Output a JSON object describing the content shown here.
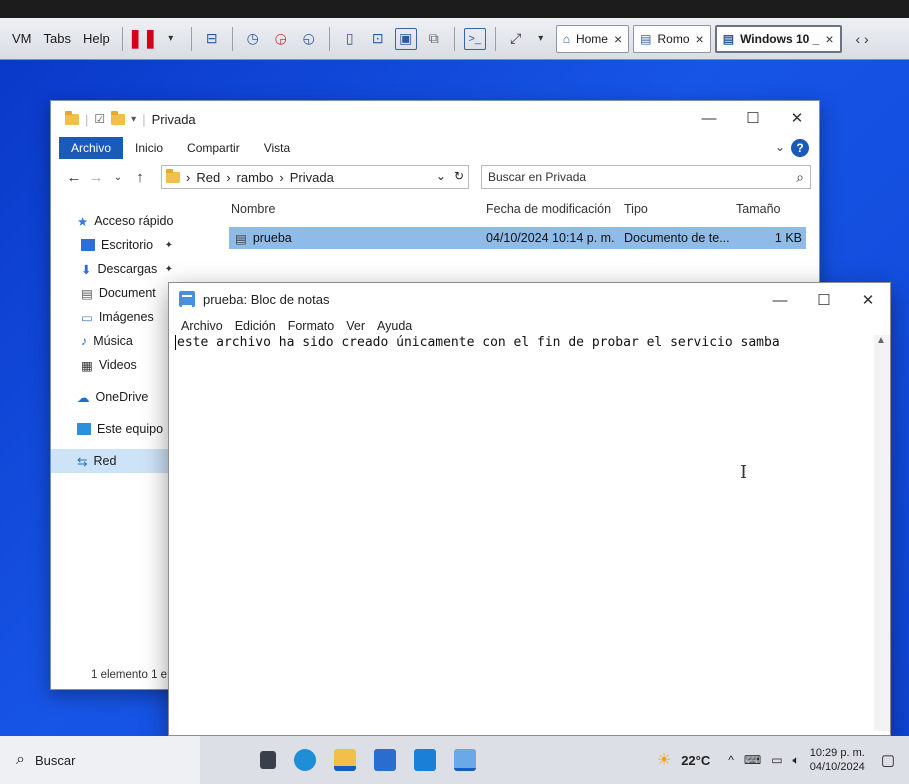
{
  "vm_toolbar": {
    "menus": [
      "VM",
      "Tabs",
      "Help"
    ],
    "tabs": [
      {
        "label": "Home",
        "icon": "home-icon"
      },
      {
        "label": "Romo",
        "icon": "vm-icon"
      },
      {
        "label": "Windows 10 _",
        "icon": "vm-icon",
        "active": true
      }
    ],
    "close_glyph": "×",
    "nav_glyph": "‹ ›"
  },
  "explorer": {
    "title": "Privada",
    "ribbon_tabs": [
      "Archivo",
      "Inicio",
      "Compartir",
      "Vista"
    ],
    "help_glyph": "?",
    "breadcrumb": [
      "Red",
      "rambo",
      "Privada"
    ],
    "search_placeholder": "Buscar en Privada",
    "columns": [
      "Nombre",
      "Fecha de modificación",
      "Tipo",
      "Tamaño"
    ],
    "sidebar": [
      {
        "label": "Acceso rápido",
        "icon": "star-icon"
      },
      {
        "label": "Escritorio",
        "icon": "desktop-icon",
        "pinned": true
      },
      {
        "label": "Descargas",
        "icon": "download-icon",
        "pinned": true
      },
      {
        "label": "Document",
        "icon": "documents-icon"
      },
      {
        "label": "Imágenes",
        "icon": "pictures-icon"
      },
      {
        "label": "Música",
        "icon": "music-icon"
      },
      {
        "label": "Videos",
        "icon": "videos-icon"
      },
      {
        "label": "OneDrive",
        "icon": "cloud-icon"
      },
      {
        "label": "Este equipo",
        "icon": "computer-icon"
      },
      {
        "label": "Red",
        "icon": "network-icon",
        "selected": true
      }
    ],
    "file": {
      "name": "prueba",
      "date": "04/10/2024 10:14 p. m.",
      "type": "Documento de te...",
      "size": "1 KB"
    },
    "status": "1 elemento   1 e"
  },
  "notepad": {
    "title": "prueba: Bloc de notas",
    "menus": [
      "Archivo",
      "Edición",
      "Formato",
      "Ver",
      "Ayuda"
    ],
    "content": "este archivo ha sido creado únicamente con el fin de probar el servicio samba"
  },
  "taskbar": {
    "search_label": "Buscar",
    "weather": "22°C",
    "time": "10:29 p. m.",
    "date": "04/10/2024"
  },
  "colors": {
    "desktop": "#1755e6",
    "selection": "#8fbbe8",
    "accent": "#1a5ab8"
  }
}
